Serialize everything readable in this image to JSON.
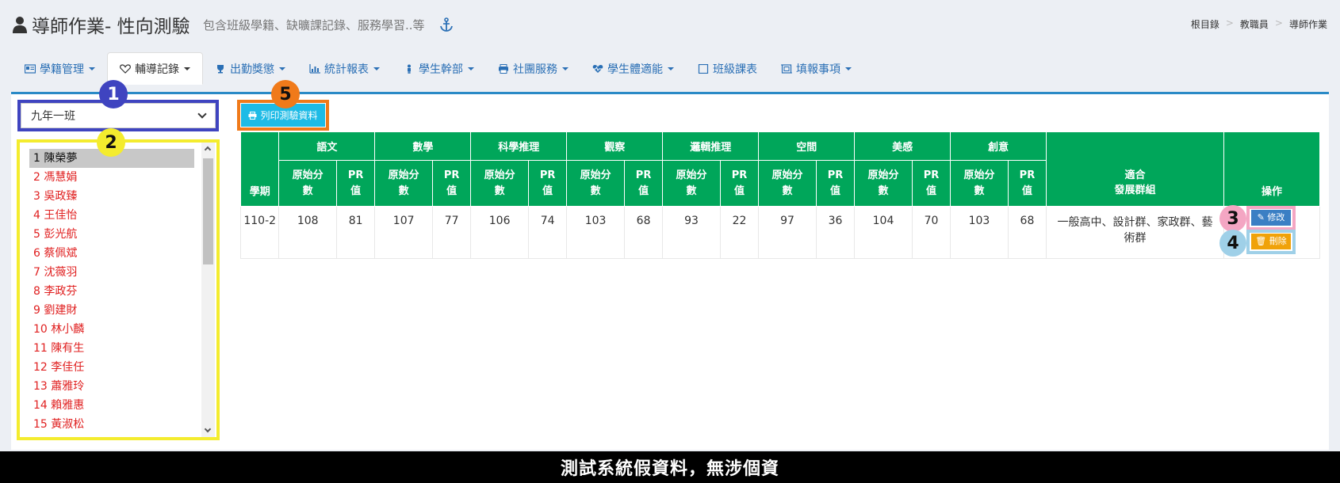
{
  "header": {
    "title": "導師作業- 性向測驗",
    "subtitle": "包含班級學籍、缺曠課記錄、服務學習..等",
    "breadcrumb": [
      "根目錄",
      "教職員",
      "導師作業"
    ]
  },
  "tabs": [
    {
      "label": "學籍管理",
      "dropdown": true,
      "icon": "id-card-icon"
    },
    {
      "label": "輔導記錄",
      "dropdown": true,
      "icon": "heart-icon",
      "active": true
    },
    {
      "label": "出勤獎懲",
      "dropdown": true,
      "icon": "trophy-icon"
    },
    {
      "label": "統計報表",
      "dropdown": true,
      "icon": "bar-chart-icon"
    },
    {
      "label": "學生幹部",
      "dropdown": true,
      "icon": "person-icon"
    },
    {
      "label": "社團服務",
      "dropdown": true,
      "icon": "printer-icon"
    },
    {
      "label": "學生體適能",
      "dropdown": true,
      "icon": "heartbeat-icon"
    },
    {
      "label": "班級課表",
      "dropdown": false,
      "icon": "square-icon"
    },
    {
      "label": "填報事項",
      "dropdown": true,
      "icon": "frame-icon"
    }
  ],
  "class_select": {
    "value": "九年一班"
  },
  "students": [
    "1 陳榮夢",
    "2 馮慧娟",
    "3 吳政臻",
    "4 王佳怡",
    "5 彭光航",
    "6 蔡佩斌",
    "7 沈薇羽",
    "8 李政芬",
    "9 劉建財",
    "10 林小麟",
    "11 陳有生",
    "12 李佳任",
    "13 蕭雅玲",
    "14 賴雅惠",
    "15 黃淑松"
  ],
  "print_button": {
    "label": "列印測驗資料"
  },
  "table": {
    "subjects": [
      "語文",
      "數學",
      "科學推理",
      "觀察",
      "邏輯推理",
      "空間",
      "美感",
      "創意"
    ],
    "raw_label_1": "原始分",
    "raw_label_2": "數",
    "pr_label_1": "PR",
    "pr_label_2": "值",
    "term_header": "學期",
    "group_header_1": "適合",
    "group_header_2": "發展群組",
    "action_header": "操作",
    "rows": [
      {
        "term": "110-2",
        "scores": [
          "108",
          "81",
          "107",
          "77",
          "106",
          "74",
          "103",
          "68",
          "93",
          "22",
          "97",
          "36",
          "104",
          "70",
          "103",
          "68"
        ],
        "group": "一般高中、設計群、家政群、藝術群",
        "edit_label": "修改",
        "delete_label": "刪除"
      }
    ]
  },
  "badges": [
    "1",
    "2",
    "3",
    "4",
    "5"
  ],
  "footer": {
    "text": "測試系統假資料，無涉個資"
  },
  "colors": {
    "accent": "#2a6fb5",
    "table_header": "#00a65a",
    "print_button": "#1ebbe6",
    "edit_button": "#3b7fc4",
    "delete_button": "#f0a20a",
    "student_text": "#e02020"
  }
}
